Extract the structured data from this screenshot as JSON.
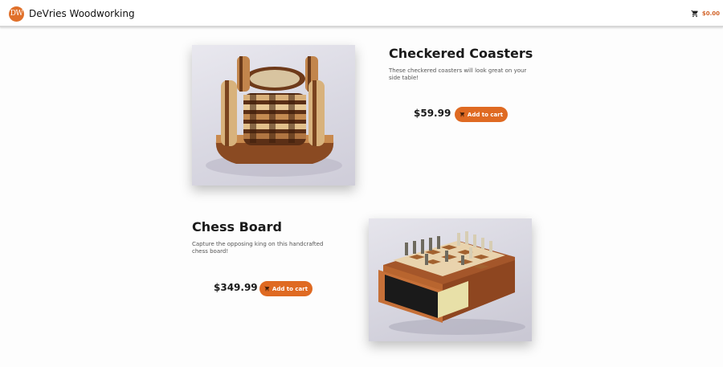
{
  "header": {
    "logo_text": "DW",
    "brand_name": "DeVries Woodworking",
    "cart_icon": "shopping-cart-icon",
    "cart_total": "$0.00"
  },
  "products": [
    {
      "title": "Checkered Coasters",
      "description": "These checkered coasters will look great on your side table!",
      "price": "$59.99",
      "button_label": "Add to cart",
      "button_icon": "cart-icon",
      "image": "coaster-set-photo"
    },
    {
      "title": "Chess Board",
      "description": "Capture the opposing king on this handcrafted chess board!",
      "price": "$349.99",
      "button_label": "Add to cart",
      "button_icon": "cart-icon",
      "image": "chess-board-photo"
    }
  ],
  "colors": {
    "accent": "#df6a22",
    "cart_total": "#d2642a",
    "logo_bg": "#e0702a"
  }
}
